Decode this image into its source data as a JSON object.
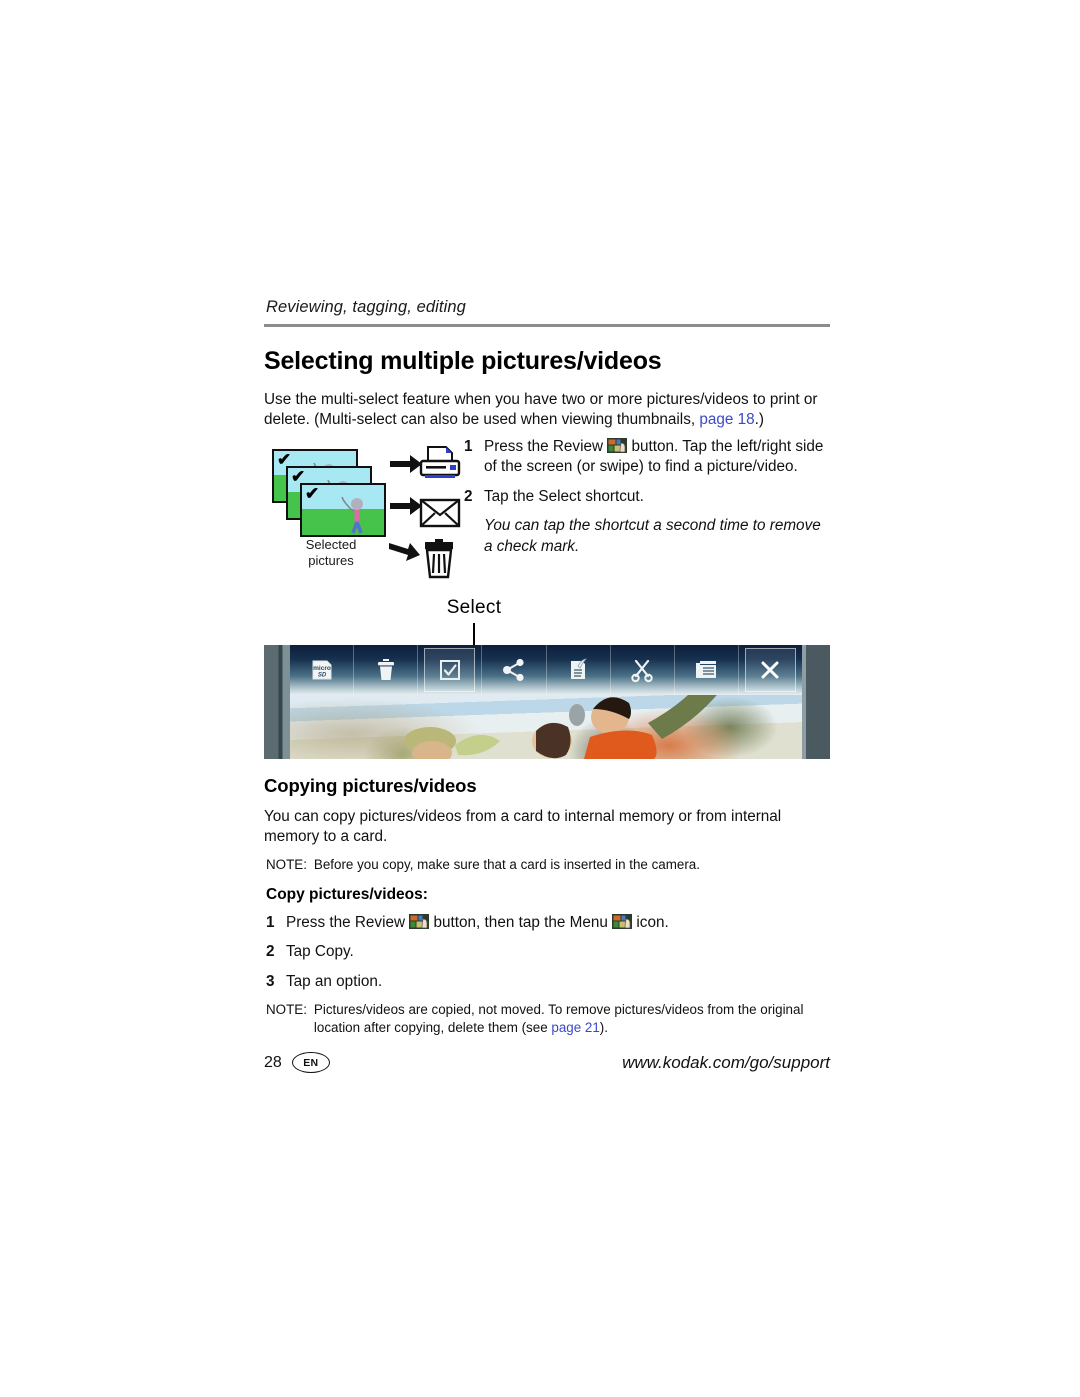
{
  "header": {
    "running_title": "Reviewing, tagging, editing"
  },
  "sections": {
    "selecting": {
      "title": "Selecting multiple pictures/videos",
      "intro_part1": "Use the multi-select feature when you have two or more pictures/videos to print or delete. (Multi-select can also be used when viewing thumbnails, ",
      "intro_link": "page 18",
      "intro_part2": ".)",
      "steps": [
        {
          "num": "1",
          "text": "Press the Review ICON button. Tap the left/right side of the screen (or swipe) to find a picture/video."
        },
        {
          "num": "2",
          "text": "Tap the Select shortcut."
        }
      ],
      "step1_before_icon": "Press the Review ",
      "step1_after_icon": " button. Tap the left/right side of the screen (or swipe) to find a picture/video.",
      "step2_text": "Tap the Select shortcut.",
      "step2_note": "You can tap the shortcut a second time to remove a check mark."
    },
    "copying": {
      "title": "Copying pictures/videos",
      "intro": "You can copy pictures/videos from a card to internal memory or from internal memory to a card.",
      "note_label": "NOTE:",
      "note_text": "Before you copy, make sure that a card is inserted in the camera.",
      "lead": "Copy pictures/videos:",
      "step1_before_icon": "Press the Review ",
      "step1_mid": " button, then tap the Menu ",
      "step1_after": " icon.",
      "step2": "Tap Copy.",
      "step3": "Tap an option.",
      "step_nums": [
        "1",
        "2",
        "3"
      ],
      "note2_label": "NOTE:",
      "note2_part1": "Pictures/videos are copied, not moved. To remove pictures/videos from the original location after copying, delete them (see ",
      "note2_link": "page 21",
      "note2_part2": ")."
    }
  },
  "illustration": {
    "caption_line1": "Selected",
    "caption_line2": "pictures",
    "photo_check": "✔",
    "destinations": [
      "printer-icon",
      "envelope-icon",
      "trash-icon"
    ]
  },
  "screen_figure": {
    "callout_label": "Select",
    "toolbar_icons": [
      {
        "name": "microsd-card-icon",
        "label": "microSD",
        "selected": false
      },
      {
        "name": "trash-icon",
        "label": "Delete",
        "selected": false
      },
      {
        "name": "checkbox-select-icon",
        "label": "Select",
        "selected": true
      },
      {
        "name": "share-icon",
        "label": "Share",
        "selected": false
      },
      {
        "name": "edit-tag-icon",
        "label": "Tag",
        "selected": false
      },
      {
        "name": "scissors-crop-icon",
        "label": "Crop",
        "selected": false
      },
      {
        "name": "menu-list-icon",
        "label": "Menu",
        "selected": false
      },
      {
        "name": "close-x-icon",
        "label": "Close",
        "selected": true
      }
    ]
  },
  "footer": {
    "page_number": "28",
    "language_badge": "EN",
    "url": "www.kodak.com/go/support"
  },
  "colors": {
    "link": "#3a49c8",
    "rule": "#8c8c8c",
    "text": "#111111"
  }
}
